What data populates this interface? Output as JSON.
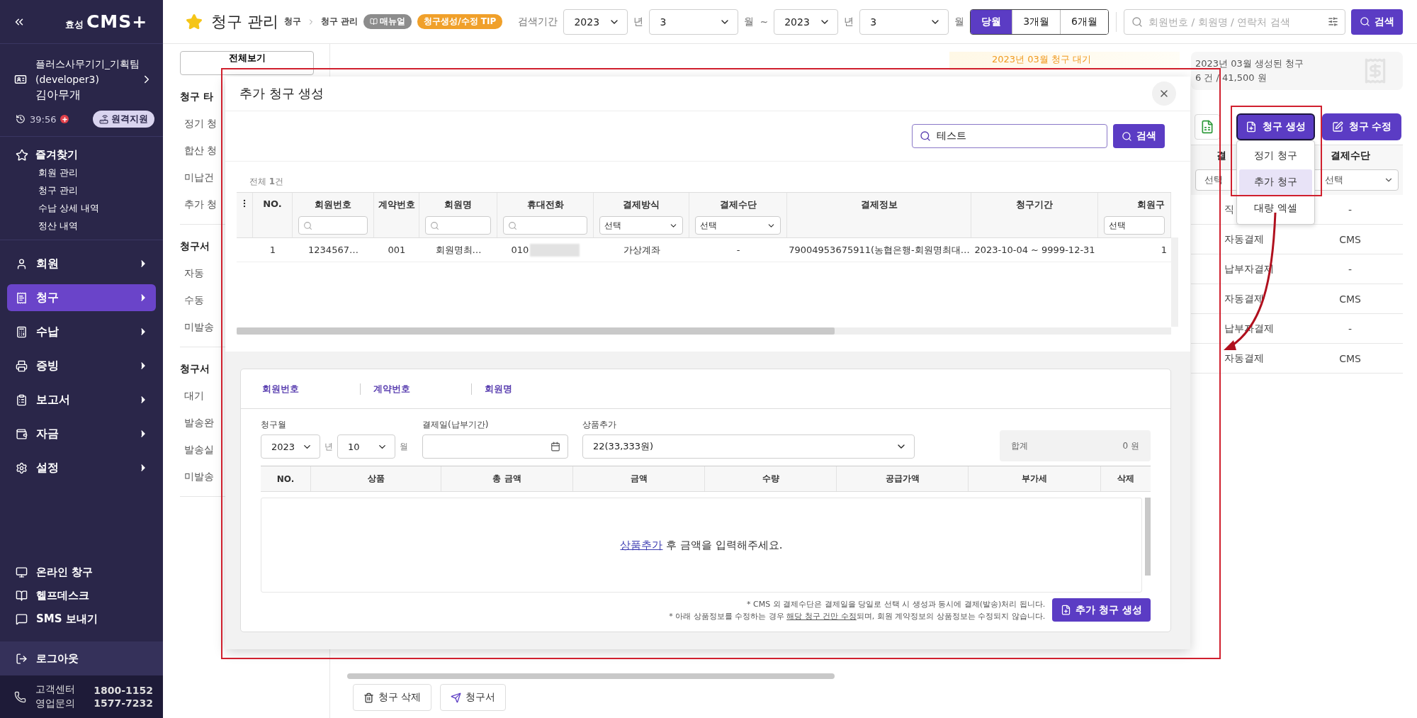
{
  "sidebar": {
    "logo_prefix": "효성",
    "logo": "CMS+",
    "profile": {
      "company": "플러스사무기기_기획팀",
      "account": "(developer3)",
      "name": "김아무개"
    },
    "session": {
      "timer": "39:56",
      "remote_button": "원격지원"
    },
    "favorites": {
      "title": "즐겨찾기",
      "items": [
        "회원 관리",
        "청구 관리",
        "수납 상세 내역",
        "정산 내역"
      ]
    },
    "menu": [
      {
        "label": "회원",
        "selected": false
      },
      {
        "label": "청구",
        "selected": true
      },
      {
        "label": "수납",
        "selected": false
      },
      {
        "label": "증빙",
        "selected": false
      },
      {
        "label": "보고서",
        "selected": false
      },
      {
        "label": "자금",
        "selected": false
      },
      {
        "label": "설정",
        "selected": false
      }
    ],
    "links": [
      "온라인 창구",
      "헬프데스크",
      "SMS 보내기"
    ],
    "logout": "로그아웃",
    "contacts": [
      {
        "label": "고객센터",
        "number": "1800-1152"
      },
      {
        "label": "영업문의",
        "number": "1577-7232"
      }
    ]
  },
  "header": {
    "title": "청구 관리",
    "breadcrumb": [
      "청구",
      "청구 관리"
    ],
    "badges": [
      {
        "label": "매뉴얼",
        "kind": "manual"
      },
      {
        "label": "청구생성/수정 TIP",
        "kind": "tip"
      }
    ],
    "period": {
      "label": "검색기간",
      "separator": "~",
      "fields": [
        {
          "value": "2023",
          "unit": "년"
        },
        {
          "value": "3",
          "unit": "월"
        },
        {
          "value": "2023",
          "unit": "년"
        },
        {
          "value": "3",
          "unit": "월"
        }
      ]
    },
    "ranges": [
      {
        "label": "당월",
        "selected": true
      },
      {
        "label": "3개월",
        "selected": false
      },
      {
        "label": "6개월",
        "selected": false
      }
    ],
    "search": {
      "placeholder": "회원번호 / 회원명 / 연락처 검색",
      "button": "검색"
    }
  },
  "filter_panel": {
    "view_all": "전체보기",
    "groups": [
      {
        "title": "청구 타",
        "items": [
          "정기 청",
          "합산 청",
          "미납건",
          "추가 청"
        ]
      },
      {
        "title": "청구서",
        "items": [
          "자동",
          "수동",
          "미발송"
        ]
      },
      {
        "title": "청구서",
        "items": [
          "대기",
          "발송완",
          "발송실",
          "미발송"
        ]
      }
    ]
  },
  "main": {
    "banner": "2023년 03월 청구 대기",
    "summary": {
      "title": "2023년 03월 생성된 청구",
      "value": "6 건 / 41,500 원"
    },
    "actions": [
      {
        "label": "청구 생성",
        "active": true
      },
      {
        "label": "청구 수정",
        "active": false
      }
    ],
    "create_menu": [
      {
        "label": "정기 청구",
        "selected": false
      },
      {
        "label": "추가 청구",
        "selected": true
      },
      {
        "label": "대량 엑셀",
        "selected": false
      }
    ],
    "columns": [
      {
        "label": "결",
        "filter": "선택"
      },
      {
        "label": "결제수단",
        "filter": "선택"
      }
    ],
    "rows": [
      [
        "직",
        "-"
      ],
      [
        "자동결제",
        "CMS"
      ],
      [
        "납부자결제",
        "-"
      ],
      [
        "자동결제",
        "CMS"
      ],
      [
        "납부자결제",
        "-"
      ],
      [
        "자동결제",
        "CMS"
      ]
    ],
    "bottom_buttons": [
      "청구 삭제",
      "청구서"
    ]
  },
  "modal": {
    "title": "추가 청구 생성",
    "search": {
      "value": "테스트",
      "button": "검색"
    },
    "total": "전체 **1**건",
    "columns": [
      {
        "kind": "menu"
      },
      {
        "label": "NO.",
        "kind": "plain"
      },
      {
        "label": "회원번호",
        "kind": "search"
      },
      {
        "label": "계약번호",
        "kind": "plain"
      },
      {
        "label": "회원명",
        "kind": "search"
      },
      {
        "label": "휴대전화",
        "kind": "search"
      },
      {
        "label": "결제방식",
        "kind": "select",
        "value": "선택"
      },
      {
        "label": "결제수단",
        "kind": "select",
        "value": "선택"
      },
      {
        "label": "결제정보",
        "kind": "plain"
      },
      {
        "label": "청구기간",
        "kind": "plain"
      },
      {
        "label": "회원구",
        "kind": "select",
        "value": "선택"
      }
    ],
    "rows": [
      {
        "phone_masked": true,
        "cells": [
          "",
          "1",
          "1234567…",
          "001",
          "회원명최…",
          "010",
          "가상계좌",
          "-",
          "79004953675911(농협은행-회원명최대…",
          "2023-10-04 ~ 9999-12-31",
          "1"
        ]
      }
    ],
    "detail": {
      "info_labels": [
        "회원번호",
        "계약번호",
        "회원명"
      ],
      "billing_month": {
        "label": "청구월",
        "year": "2023",
        "year_unit": "년",
        "month": "10",
        "month_unit": "월"
      },
      "pay_date": {
        "label": "결제일(납부기간)"
      },
      "product": {
        "label": "상품추가",
        "value": "22(33,333원)"
      },
      "total": {
        "label": "합계",
        "value": "0 원"
      },
      "columns": [
        "NO.",
        "상품",
        "총 금액",
        "금액",
        "수량",
        "공급가액",
        "부가세",
        "삭제"
      ],
      "empty_link": "상품추가",
      "empty_text": "후 금액을 입력해주세요.",
      "notes": [
        {
          "parts": [
            {
              "text": "* CMS 외 결제수단은 결제일을 당일로 선택 시 생성과 동시에 결제(발송)처리 됩니다.",
              "underline": false
            }
          ]
        },
        {
          "parts": [
            {
              "text": "* 아래 상품정보를 수정하는 경우 ",
              "underline": false
            },
            {
              "text": "해당 청구 건만 수정",
              "underline": true
            },
            {
              "text": "되며, 회원 계약정보의 상품정보는 수정되지 않습니다.",
              "underline": false
            }
          ]
        }
      ],
      "submit": "추가 청구 생성"
    }
  }
}
